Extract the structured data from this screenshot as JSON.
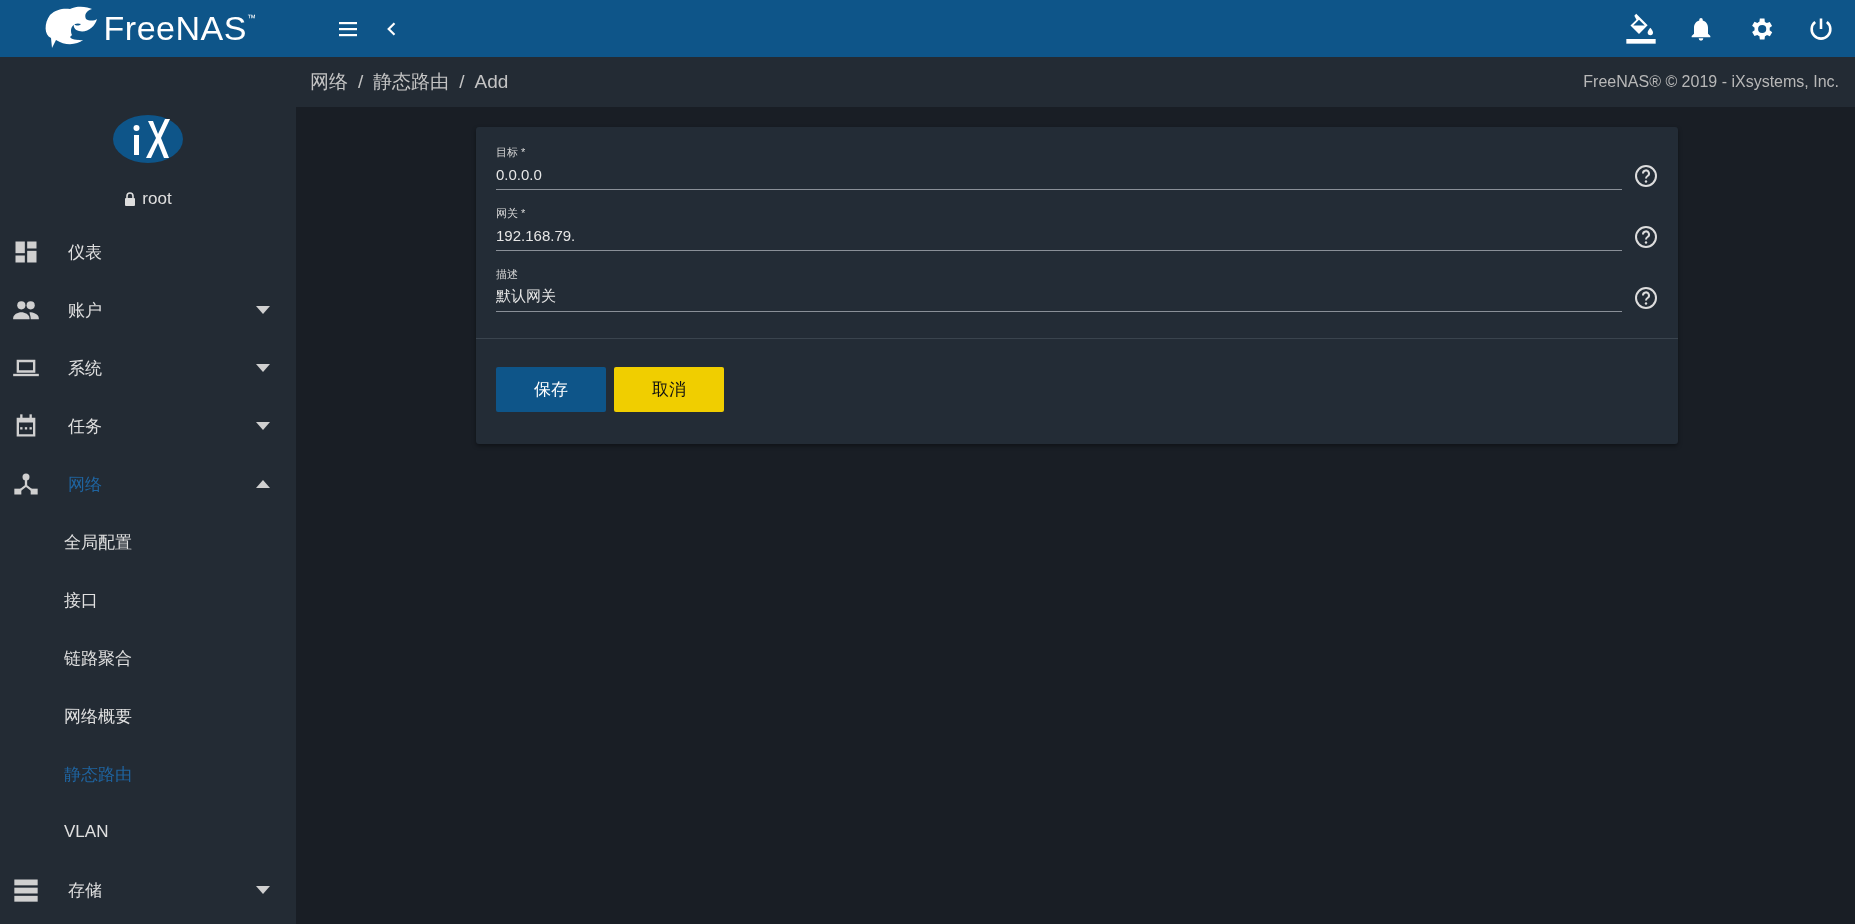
{
  "header": {
    "brand": "FreeNAS",
    "brand_mark": "™"
  },
  "user": {
    "name": "root"
  },
  "sidebar": {
    "items": [
      {
        "label": "仪表",
        "kind": "link",
        "selected": false
      },
      {
        "label": "账户",
        "kind": "group",
        "expanded": false,
        "selected": false
      },
      {
        "label": "系统",
        "kind": "group",
        "expanded": false,
        "selected": false
      },
      {
        "label": "任务",
        "kind": "group",
        "expanded": false,
        "selected": false
      },
      {
        "label": "网络",
        "kind": "group",
        "expanded": true,
        "selected": true,
        "children": [
          {
            "label": "全局配置",
            "selected": false
          },
          {
            "label": "接口",
            "selected": false
          },
          {
            "label": "链路聚合",
            "selected": false
          },
          {
            "label": "网络概要",
            "selected": false
          },
          {
            "label": "静态路由",
            "selected": true
          },
          {
            "label": "VLAN",
            "selected": false
          }
        ]
      },
      {
        "label": "存储",
        "kind": "group",
        "expanded": false,
        "selected": false
      }
    ]
  },
  "breadcrumb": {
    "separator": "/",
    "items": [
      "网络",
      "静态路由",
      "Add"
    ]
  },
  "copyright": "FreeNAS® © 2019 - iXsystems, Inc.",
  "form": {
    "fields": [
      {
        "label": "目标 *",
        "value": "0.0.0.0"
      },
      {
        "label": "网关 *",
        "value": "192.168.79."
      },
      {
        "label": "描述",
        "value": "默认网关"
      }
    ],
    "buttons": [
      {
        "label": "保存",
        "kind": "primary"
      },
      {
        "label": "取消",
        "kind": "secondary"
      }
    ]
  }
}
